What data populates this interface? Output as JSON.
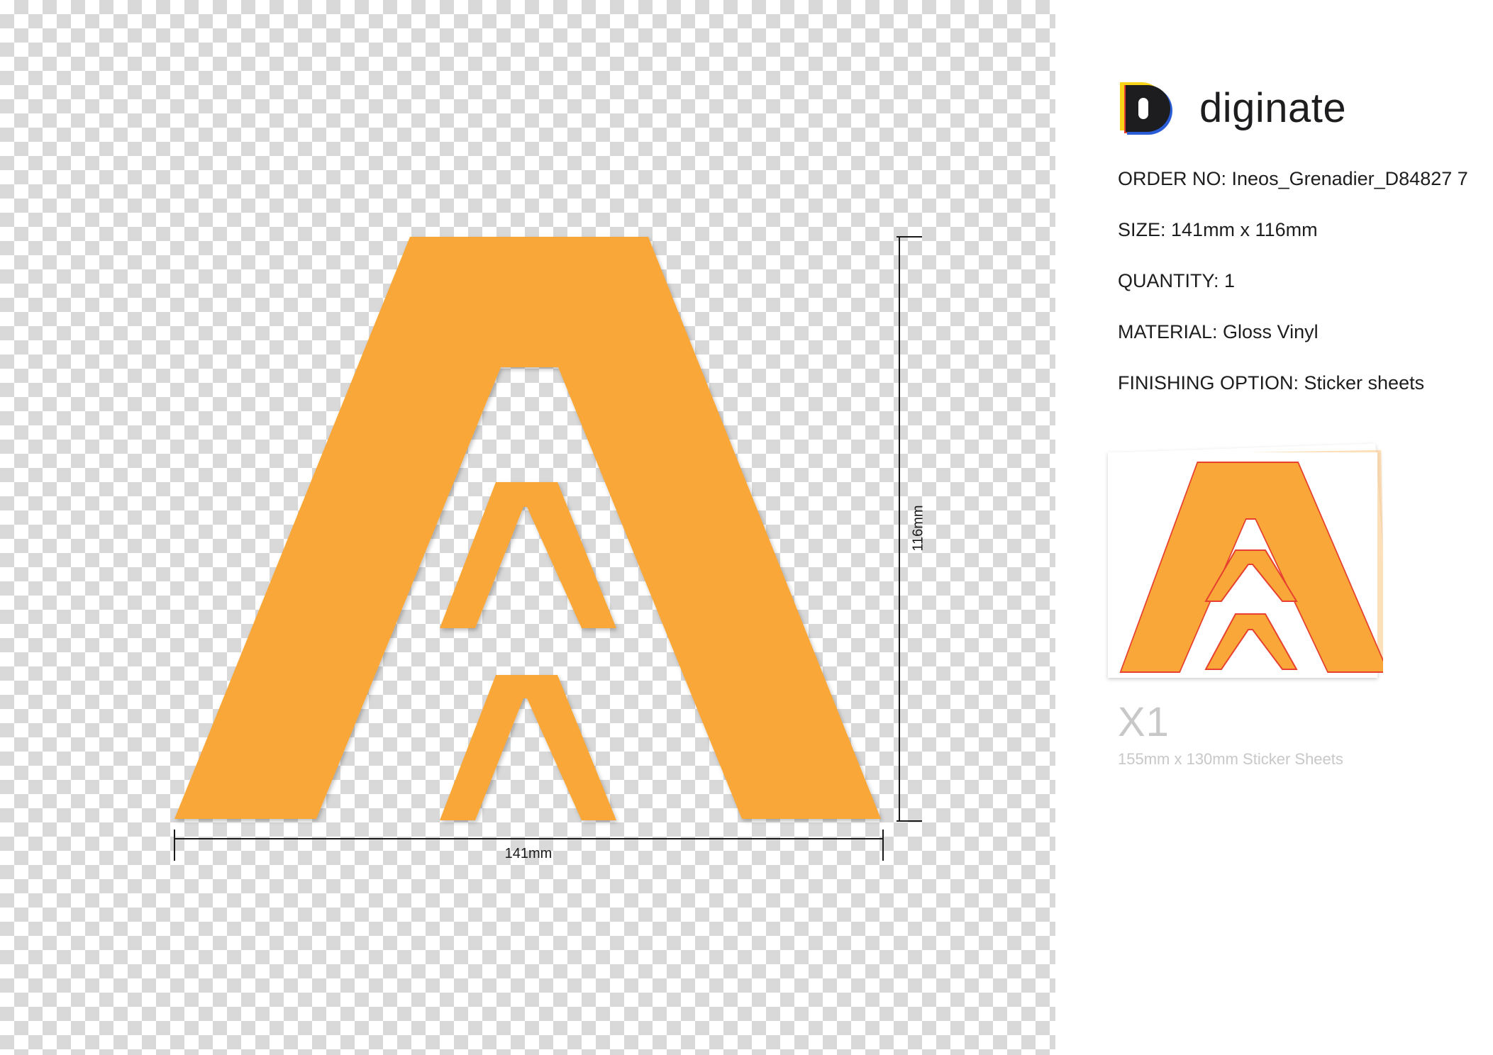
{
  "dimensions": {
    "width_label": "141mm",
    "height_label": "116mm"
  },
  "brand": {
    "name": "diginate"
  },
  "order": {
    "order_no_label": "ORDER NO:",
    "order_no": " Ineos_Grenadier_D84827 7",
    "size_label": "SIZE:",
    "size": " 141mm x 116mm",
    "quantity_label": "QUANTITY:",
    "quantity": " 1",
    "material_label": "MATERIAL:",
    "material": " Gloss Vinyl",
    "finishing_label": "FINISHING OPTION:",
    "finishing": " Sticker sheets"
  },
  "sheet_preview": {
    "count": "X1",
    "size_text": "155mm x 130mm Sticker Sheets"
  },
  "colors": {
    "sticker": "#F9A738",
    "cut_line": "#E8402E",
    "brand_blue": "#2A5CD6",
    "brand_red": "#E8402E",
    "brand_yellow": "#F7D417"
  }
}
